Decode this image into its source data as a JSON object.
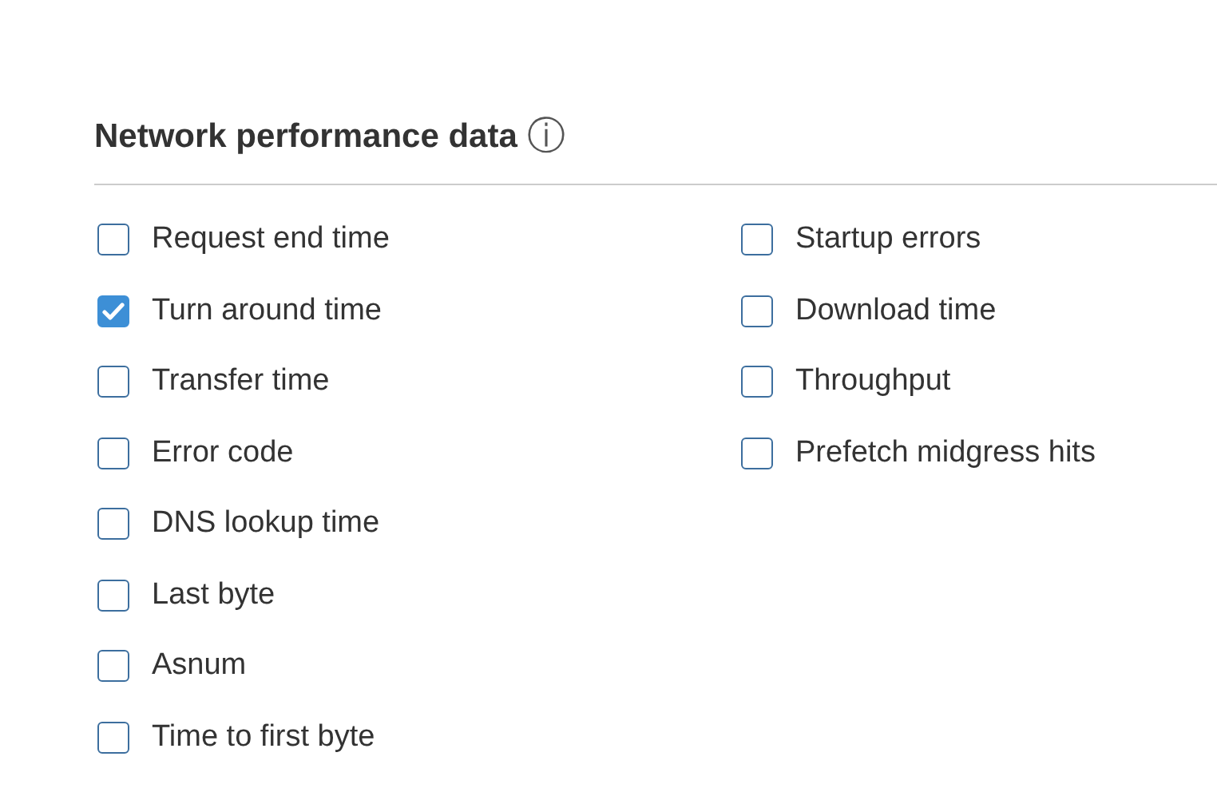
{
  "section": {
    "title": "Network performance data",
    "info_icon": "ⓘ"
  },
  "columns": [
    [
      {
        "label": "Request end time",
        "checked": false
      },
      {
        "label": "Turn around time",
        "checked": true
      },
      {
        "label": "Transfer time",
        "checked": false
      },
      {
        "label": "Error code",
        "checked": false
      },
      {
        "label": "DNS lookup time",
        "checked": false
      },
      {
        "label": "Last byte",
        "checked": false
      },
      {
        "label": "Asnum",
        "checked": false
      },
      {
        "label": "Time to first byte",
        "checked": false
      }
    ],
    [
      {
        "label": "Startup errors",
        "checked": false
      },
      {
        "label": "Download time",
        "checked": false
      },
      {
        "label": "Throughput",
        "checked": false
      },
      {
        "label": "Prefetch midgress hits",
        "checked": false
      }
    ]
  ]
}
